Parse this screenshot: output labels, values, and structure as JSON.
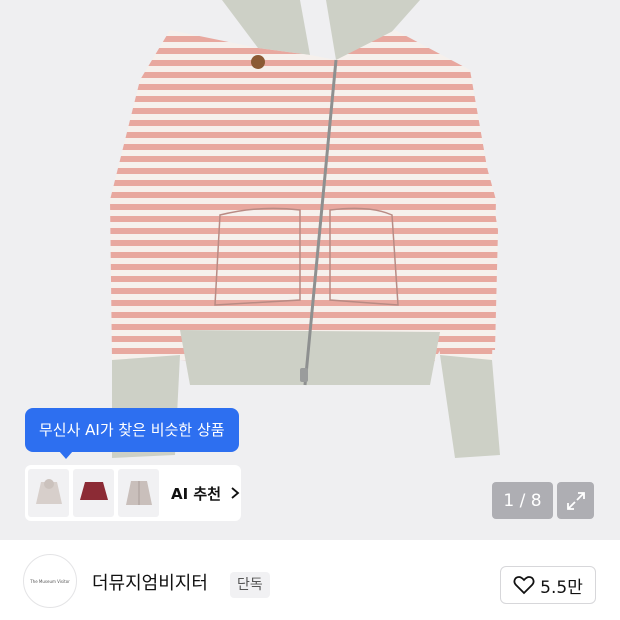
{
  "product_image": {
    "alt_icon": "striped-zip-hoodie"
  },
  "ai_tooltip": {
    "text": "무신사 AI가 찾은 비슷한 상품"
  },
  "ai_recommend": {
    "label": "AI 추천",
    "thumbnails": [
      "grey-hoodie-icon",
      "burgundy-sweater-icon",
      "grey-jacket-icon"
    ]
  },
  "gallery": {
    "counter": "1 / 8"
  },
  "brand": {
    "logo_text": "The Museum Visitor",
    "name": "더뮤지엄비지터",
    "badge": "단독"
  },
  "like": {
    "count": "5.5만"
  },
  "colors": {
    "accent": "#2d6ff0",
    "stripe": "#e8a89f",
    "rib": "#cdd0c6"
  }
}
